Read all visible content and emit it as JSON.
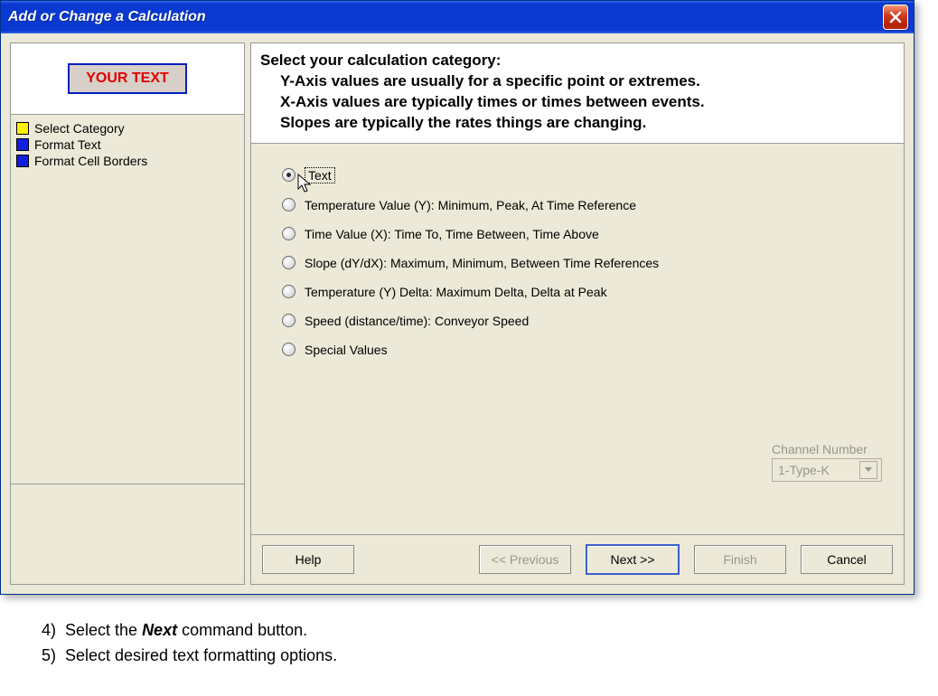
{
  "window": {
    "title": "Add or Change a Calculation"
  },
  "preview": {
    "text": "YOUR TEXT"
  },
  "steps": [
    {
      "label": "Select Category",
      "color": "yellow"
    },
    {
      "label": "Format Text",
      "color": "blue"
    },
    {
      "label": "Format Cell Borders",
      "color": "blue"
    }
  ],
  "header": {
    "title": "Select your calculation category:",
    "line1": "Y-Axis values are usually for a specific point or extremes.",
    "line2": "X-Axis values are typically times or times between events.",
    "line3": "Slopes are typically the rates things are changing."
  },
  "radios": [
    {
      "label": "Text",
      "selected": true
    },
    {
      "label": "Temperature Value (Y):  Minimum, Peak, At Time Reference",
      "selected": false
    },
    {
      "label": "Time Value (X):  Time To, Time Between, Time Above",
      "selected": false
    },
    {
      "label": "Slope (dY/dX):  Maximum, Minimum, Between Time References",
      "selected": false
    },
    {
      "label": "Temperature (Y) Delta:  Maximum Delta, Delta at Peak",
      "selected": false
    },
    {
      "label": "Speed (distance/time): Conveyor Speed",
      "selected": false
    },
    {
      "label": "Special  Values",
      "selected": false
    }
  ],
  "channel": {
    "label": "Channel Number",
    "value": "1-Type-K"
  },
  "buttons": {
    "help": "Help",
    "previous": "<< Previous",
    "next": "Next >>",
    "finish": "Finish",
    "cancel": "Cancel"
  },
  "instructions": {
    "items": [
      {
        "num": "4)",
        "pre": "Select the ",
        "bold": "Next",
        "post": " command button."
      },
      {
        "num": "5)",
        "pre": "Select desired text formatting options.",
        "bold": "",
        "post": ""
      }
    ]
  }
}
